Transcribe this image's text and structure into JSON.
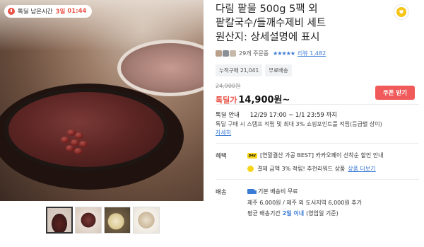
{
  "timer": {
    "label": "톡딜 남은시간",
    "day": "3일",
    "time": "01:44"
  },
  "product": {
    "title_line1": "다림 팥물 500g 5팩 외",
    "title_line2": "팥칼국수/들깨수제비 세트",
    "title_line3": "원산지: 상세설명에 표시"
  },
  "reviews": {
    "orders": "29개 주문중",
    "stars": "★★★★★",
    "review_link": "리뷰 1,482"
  },
  "badges": [
    "누적구매 21,041",
    "무료배송"
  ],
  "price": {
    "original": "24,900원",
    "sale_label": "톡딜가",
    "sale_price": "14,900원~",
    "coupon_button": "쿠폰 받기"
  },
  "deal": {
    "label": "톡딜 안내",
    "period": "12/29 17:00 ~ 1/1 23:59 까지",
    "desc": "톡딜 구매 시 스탬프 적립 및 최대 3% 쇼핑포인트를 적립(등급별 상이)",
    "more": "자세히"
  },
  "benefits": {
    "label": "혜택",
    "pay_icon_text": "pay",
    "item1": "[연말결산 가공 BEST] 카카오페이 선착순 할인 안내",
    "item2": "결제 금액 3% 적립! 추천리워드 상품",
    "item2_more": "상품 더보기"
  },
  "shipping": {
    "label": "배송",
    "line1": "기본 배송비 무료",
    "line2": "제주 6,000원 / 제주 외 도서지역 6,000원 추가",
    "line3_prefix": "평균 배송기간",
    "line3_value": "2일 이내",
    "line3_suffix": "(영업일 기준)"
  },
  "icons": [
    "clock-icon",
    "heart-icon",
    "star-icon",
    "pay-icon",
    "coin-icon",
    "truck-icon"
  ],
  "colors": {
    "accent_red": "#e8554a",
    "link_blue": "#3a7bd5",
    "kakao_yellow": "#f7d518"
  }
}
